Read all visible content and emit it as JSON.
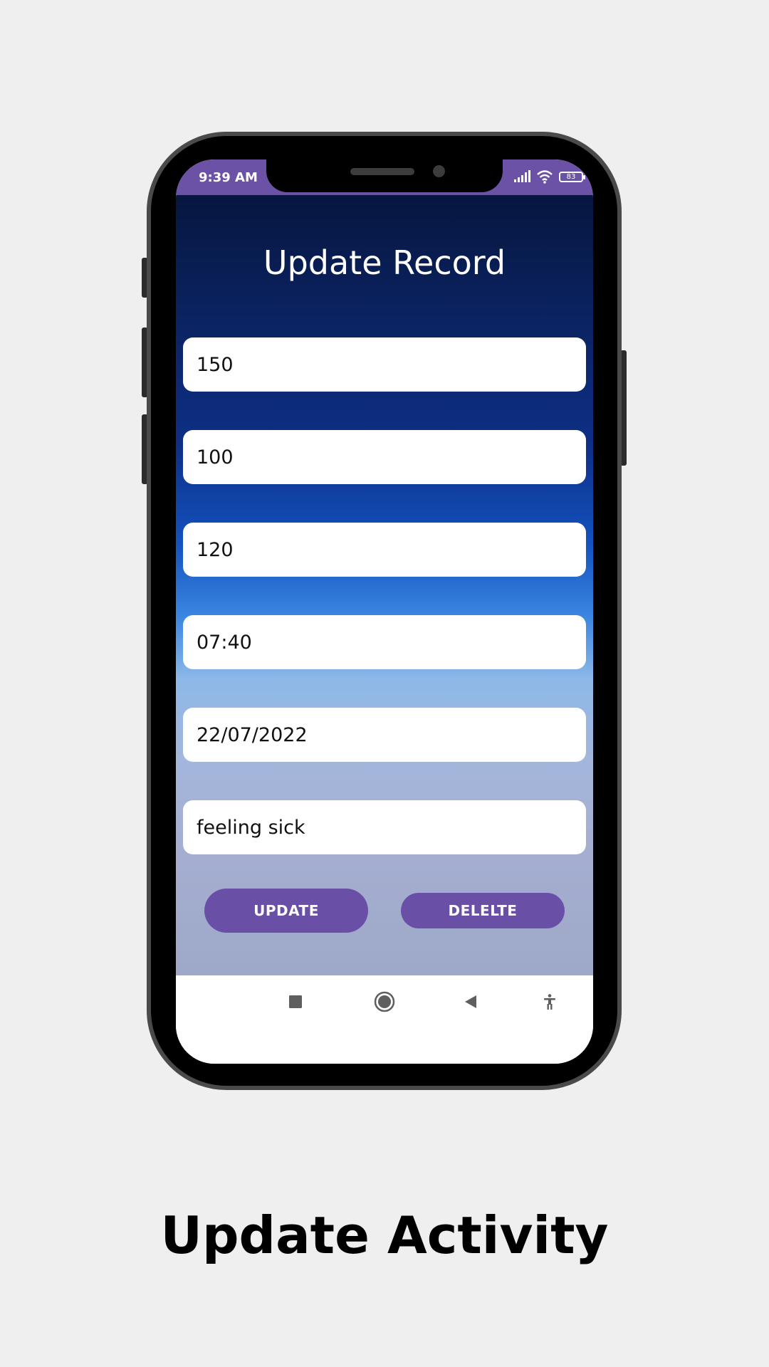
{
  "status_bar": {
    "time": "9:39 AM",
    "battery": "83"
  },
  "screen": {
    "title": "Update Record",
    "fields": [
      {
        "value": "150"
      },
      {
        "value": "100"
      },
      {
        "value": "120"
      },
      {
        "value": "07:40"
      },
      {
        "value": "22/07/2022"
      },
      {
        "value": "feeling sick"
      }
    ],
    "buttons": {
      "update": "UPDATE",
      "delete": "DELELTE"
    }
  },
  "nav_bar": {
    "icons": [
      "recents-square-icon",
      "home-circle-icon",
      "back-triangle-icon",
      "accessibility-icon"
    ]
  },
  "caption": "Update Activity",
  "colors": {
    "accent": "#6b52a6",
    "button": "#6a4fa6",
    "page_background": "#efefef"
  }
}
